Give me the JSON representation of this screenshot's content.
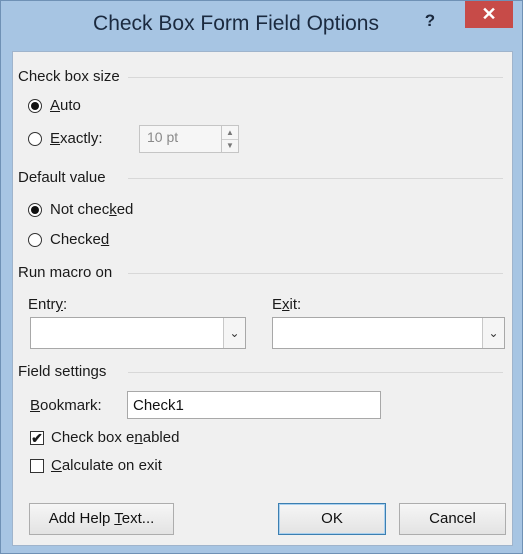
{
  "window": {
    "title": "Check Box Form Field Options",
    "help_label": "?",
    "close_label": "✕"
  },
  "check_box_size": {
    "heading": "Check box size",
    "auto": {
      "pre": "",
      "key": "A",
      "post": "uto",
      "selected": true
    },
    "exactly": {
      "pre": "",
      "key": "E",
      "post": "xactly:",
      "selected": false
    },
    "size_value": "10 pt"
  },
  "default_value": {
    "heading": "Default value",
    "not_checked": {
      "pre": "Not chec",
      "key": "k",
      "post": "ed",
      "selected": true
    },
    "checked": {
      "pre": "Checke",
      "key": "d",
      "post": "",
      "selected": false
    }
  },
  "run_macro": {
    "heading": "Run macro on",
    "entry": {
      "pre": "Entr",
      "key": "y",
      "post": ":",
      "value": ""
    },
    "exit": {
      "pre": "E",
      "key": "x",
      "post": "it:",
      "value": ""
    }
  },
  "field_settings": {
    "heading": "Field settings",
    "bookmark": {
      "pre": "",
      "key": "B",
      "post": "ookmark:",
      "value": "Check1"
    },
    "enabled": {
      "pre": "Check box e",
      "key": "n",
      "post": "abled",
      "checked": true,
      "mark": "✔"
    },
    "calculate": {
      "pre": "",
      "key": "C",
      "post": "alculate on exit",
      "checked": false,
      "mark": ""
    }
  },
  "buttons": {
    "help_text": {
      "pre": "Add Help ",
      "key": "T",
      "post": "ext..."
    },
    "ok": "OK",
    "cancel": "Cancel"
  },
  "icons": {
    "dropdown": "chevron-down-icon",
    "spin_up": "triangle-up-icon",
    "spin_down": "triangle-down-icon"
  },
  "colors": {
    "titlebar": "#a7c5e3",
    "close": "#c74b48",
    "panel": "#f0f0f0",
    "default_button_border": "#3c7fb1"
  }
}
